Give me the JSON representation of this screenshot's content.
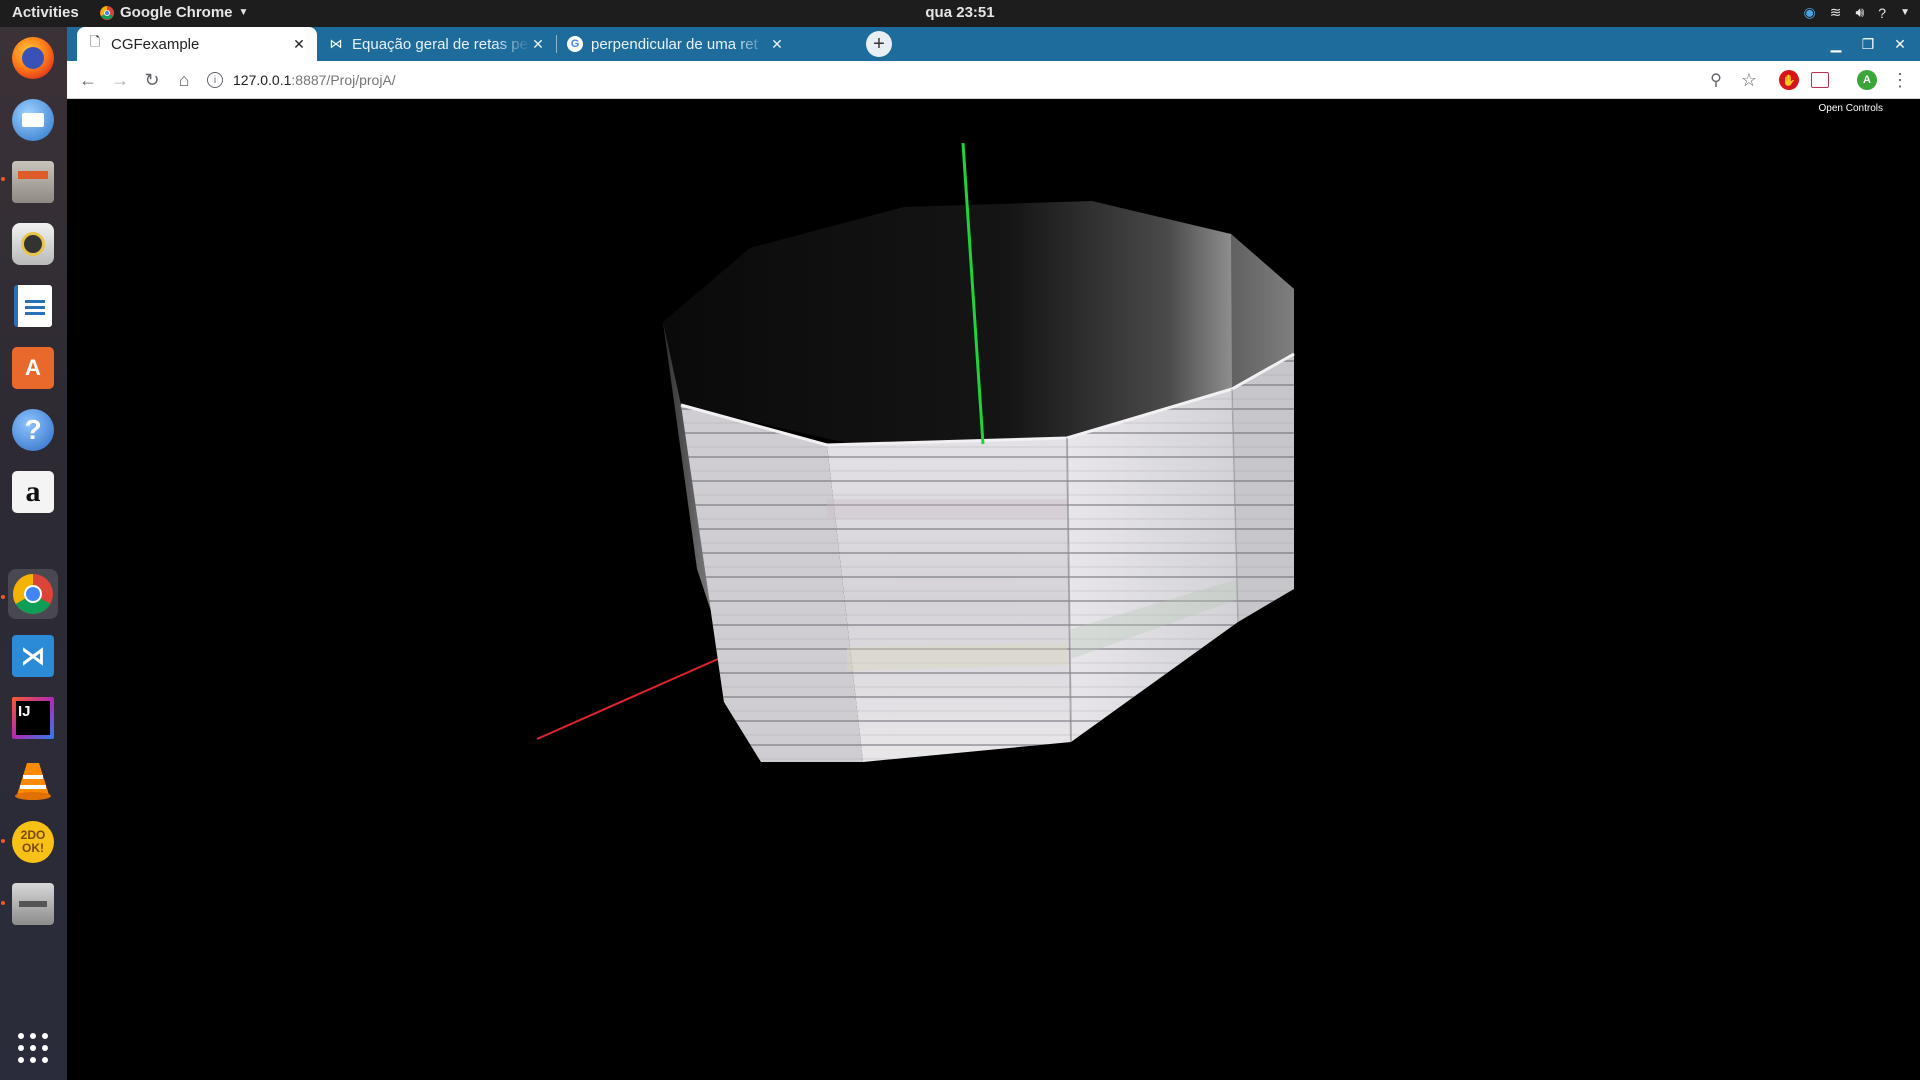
{
  "topbar": {
    "activities": "Activities",
    "app_name": "Google Chrome",
    "clock": "qua 23:51"
  },
  "dock": {
    "items": [
      {
        "name": "firefox-icon",
        "glyph": ""
      },
      {
        "name": "thunderbird-icon",
        "glyph": ""
      },
      {
        "name": "files-icon",
        "glyph": ""
      },
      {
        "name": "rhythmbox-icon",
        "glyph": ""
      },
      {
        "name": "libreoffice-writer-icon",
        "glyph": ""
      },
      {
        "name": "software-center-icon",
        "glyph": "A"
      },
      {
        "name": "help-icon",
        "glyph": "?"
      },
      {
        "name": "amazon-icon",
        "glyph": "a"
      },
      {
        "name": "chrome-icon",
        "glyph": ""
      },
      {
        "name": "vscode-icon",
        "glyph": ""
      },
      {
        "name": "intellij-icon",
        "glyph": "IJ"
      },
      {
        "name": "vlc-icon",
        "glyph": ""
      },
      {
        "name": "twodo-icon",
        "glyph": "2DO OK!"
      },
      {
        "name": "scanner-icon",
        "glyph": ""
      }
    ]
  },
  "browser": {
    "tabs": [
      {
        "title": "CGFexample",
        "active": true
      },
      {
        "title": "Equação geral de retas pe",
        "active": false
      },
      {
        "title": "perpendicular de uma ret",
        "active": false
      }
    ],
    "url_host": "127.0.0.1",
    "url_path": ":8887/Proj/projA/",
    "profile_initial": "A"
  },
  "page": {
    "open_controls": "Open Controls"
  },
  "colors": {
    "tabstrip": "#1e6c9b",
    "axis_x": "#e0242a",
    "axis_y": "#1fd33a"
  }
}
